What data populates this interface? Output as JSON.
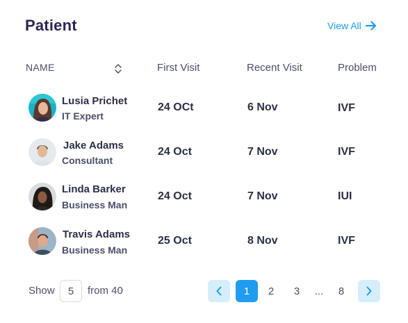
{
  "header": {
    "title": "Patient",
    "view_all": "View All"
  },
  "table": {
    "columns": {
      "name": "NAME",
      "first_visit": "First Visit",
      "recent_visit": "Recent Visit",
      "problem": "Problem"
    },
    "rows": [
      {
        "name": "Lusia Prichet",
        "role": "IT Expert",
        "first_visit": "24 OCt",
        "recent_visit": "6 Nov",
        "problem": "IVF"
      },
      {
        "name": "Jake Adams",
        "role": "Consultant",
        "first_visit": "24 Oct",
        "recent_visit": "7 Nov",
        "problem": "IVF"
      },
      {
        "name": "Linda Barker",
        "role": "Business Man",
        "first_visit": "24 Oct",
        "recent_visit": "7 Nov",
        "problem": "IUI"
      },
      {
        "name": "Travis Adams",
        "role": "Business Man",
        "first_visit": "25 Oct",
        "recent_visit": "8 Nov",
        "problem": "IVF"
      }
    ]
  },
  "footer": {
    "show_label": "Show",
    "page_size": "5",
    "from_label": "from 40",
    "pages": [
      "1",
      "2",
      "3",
      "...",
      "8"
    ],
    "current_page": "1"
  },
  "colors": {
    "accent": "#1f9cf0",
    "accent_light": "#d6eefc",
    "title": "#2b2656"
  }
}
